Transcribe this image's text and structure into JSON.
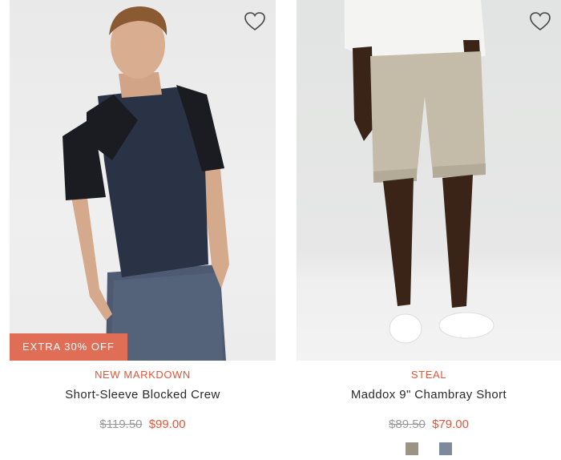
{
  "products": [
    {
      "label": "NEW MARKDOWN",
      "name": "Short-Sleeve Blocked Crew",
      "original_price": "$119.50",
      "sale_price": "$99.00",
      "promo_badge": "EXTRA 30% OFF",
      "wishlist_icon": "heart-outline-icon",
      "swatches": []
    },
    {
      "label": "STEAL",
      "name": "Maddox 9\" Chambray Short",
      "original_price": "$89.50",
      "sale_price": "$79.00",
      "wishlist_icon": "heart-outline-icon",
      "swatches": [
        {
          "color": "#9b9383"
        },
        {
          "color": "#7d8a9c"
        }
      ]
    }
  ],
  "colors": {
    "sale": "#e0563a",
    "badge": "#e06e57",
    "strikethrough": "#9a9a9a"
  }
}
